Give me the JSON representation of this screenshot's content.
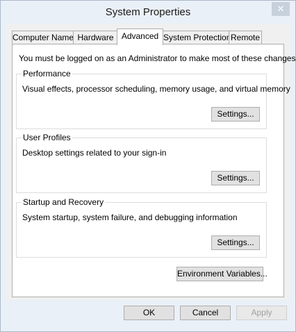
{
  "window": {
    "title": "System Properties",
    "close_glyph": "✕"
  },
  "tabs": [
    {
      "label": "Computer Name",
      "active": false
    },
    {
      "label": "Hardware",
      "active": false
    },
    {
      "label": "Advanced",
      "active": true
    },
    {
      "label": "System Protection",
      "active": false
    },
    {
      "label": "Remote",
      "active": false
    }
  ],
  "advanced": {
    "notice": "You must be logged on as an Administrator to make most of these changes.",
    "performance": {
      "label": "Performance",
      "description": "Visual effects, processor scheduling, memory usage, and virtual memory",
      "button": "Settings..."
    },
    "user_profiles": {
      "label": "User Profiles",
      "description": "Desktop settings related to your sign-in",
      "button": "Settings..."
    },
    "startup_recovery": {
      "label": "Startup and Recovery",
      "description": "System startup, system failure, and debugging information",
      "button": "Settings..."
    },
    "env_button": "Environment Variables..."
  },
  "footer": {
    "ok": "OK",
    "cancel": "Cancel",
    "apply": "Apply",
    "apply_enabled": false
  }
}
